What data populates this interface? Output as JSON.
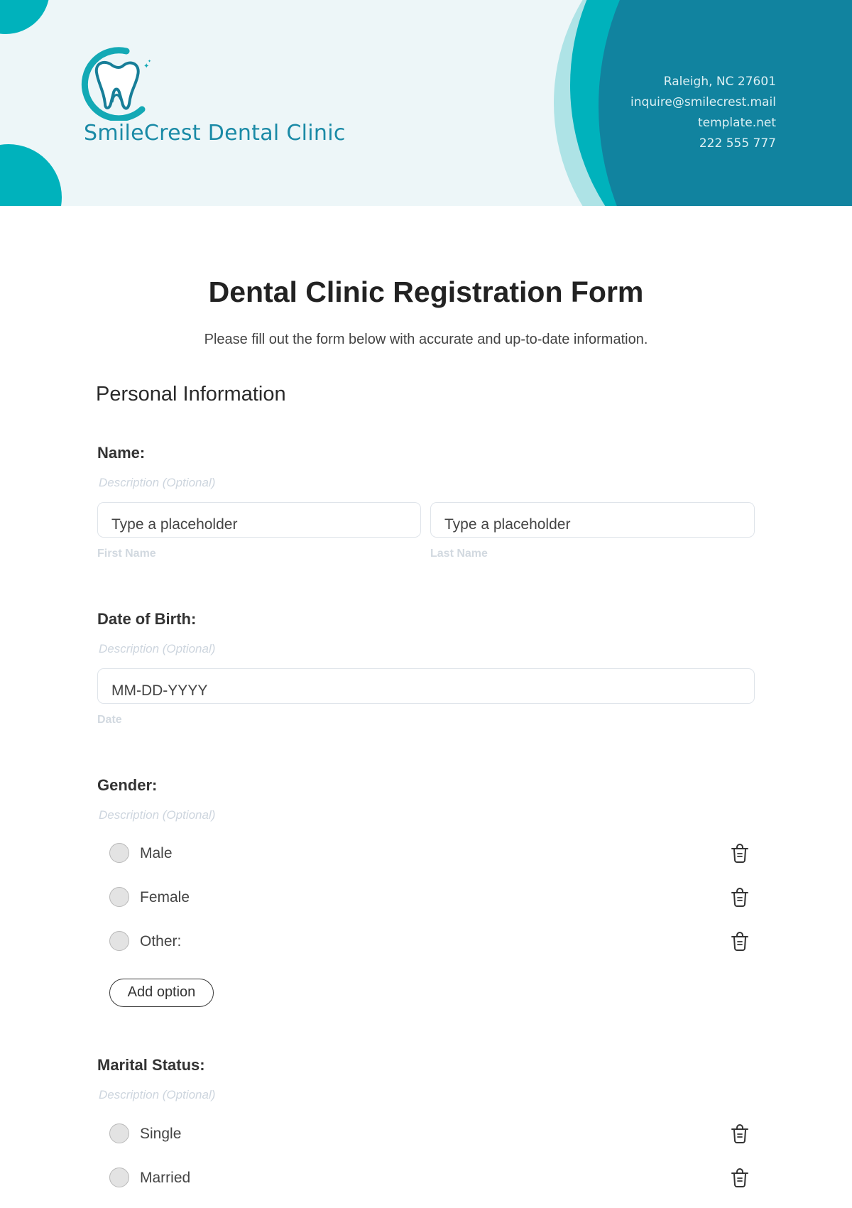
{
  "header": {
    "brand_name": "SmileCrest Dental Clinic",
    "contact": {
      "address": "Raleigh, NC 27601",
      "email": "inquire@smilecrest.mail",
      "website": "template.net",
      "phone": "222 555 777"
    },
    "colors": {
      "background": "#EDF6F8",
      "teal": "#00B2BC",
      "light_teal": "#AEE3E6",
      "dark_teal": "#11839F"
    }
  },
  "form": {
    "title": "Dental Clinic Registration Form",
    "subtitle": "Please fill out the form below with accurate and up-to-date information.",
    "section_title": "Personal Information",
    "questions": {
      "name": {
        "label": "Name:",
        "description": "Description (Optional)",
        "first_placeholder": "Type a placeholder",
        "first_sublabel": "First Name",
        "last_placeholder": "Type a placeholder",
        "last_sublabel": "Last Name"
      },
      "dob": {
        "label": "Date of Birth:",
        "description": "Description (Optional)",
        "placeholder": "MM-DD-YYYY",
        "sublabel": "Date"
      },
      "gender": {
        "label": "Gender:",
        "description": "Description (Optional)",
        "options": [
          "Male",
          "Female",
          "Other:"
        ],
        "add_option_label": "Add option"
      },
      "marital": {
        "label": "Marital Status:",
        "description": "Description (Optional)",
        "options": [
          "Single",
          "Married"
        ]
      }
    }
  },
  "icons": {
    "delete": "trash-icon",
    "logo": "tooth-logo-icon"
  }
}
